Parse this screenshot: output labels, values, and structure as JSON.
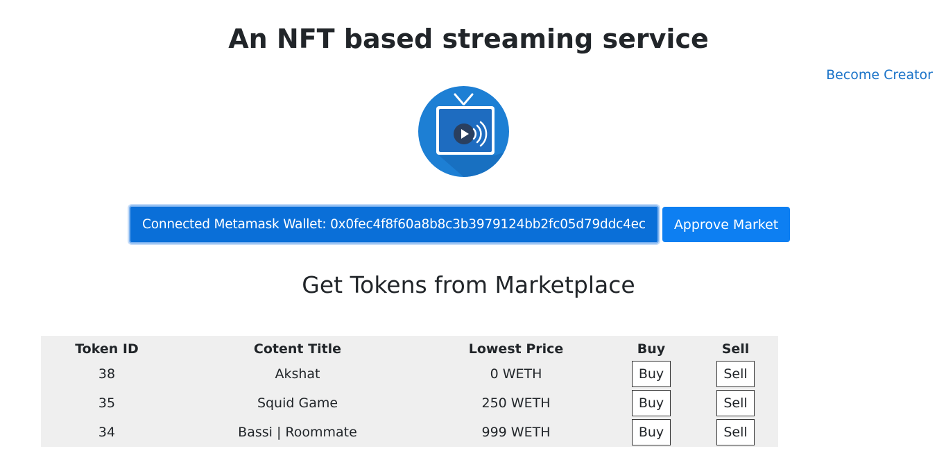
{
  "header": {
    "title": "An NFT based streaming service",
    "creator_link": "Become Creator",
    "logo_icon": "tv-stream-icon"
  },
  "wallet": {
    "connected_label": "Connected Metamask Wallet: 0x0fec4f8f60a8b8c3b3979124bb2fc05d79ddc4ec",
    "approve_label": "Approve Market"
  },
  "marketplace": {
    "title": "Get Tokens from Marketplace",
    "columns": [
      "Token ID",
      "Cotent Title",
      "Lowest Price",
      "Buy",
      "Sell"
    ],
    "rows": [
      {
        "token_id": "38",
        "title": "Akshat",
        "price": "0 WETH",
        "buy": "Buy",
        "sell": "Sell"
      },
      {
        "token_id": "35",
        "title": "Squid Game",
        "price": "250 WETH",
        "buy": "Buy",
        "sell": "Sell"
      },
      {
        "token_id": "34",
        "title": "Bassi | Roommate",
        "price": "999 WETH",
        "buy": "Buy",
        "sell": "Sell"
      }
    ]
  },
  "colors": {
    "primary": "#0d7ff2",
    "link": "#1a73c8",
    "table_bg": "#efefef"
  }
}
